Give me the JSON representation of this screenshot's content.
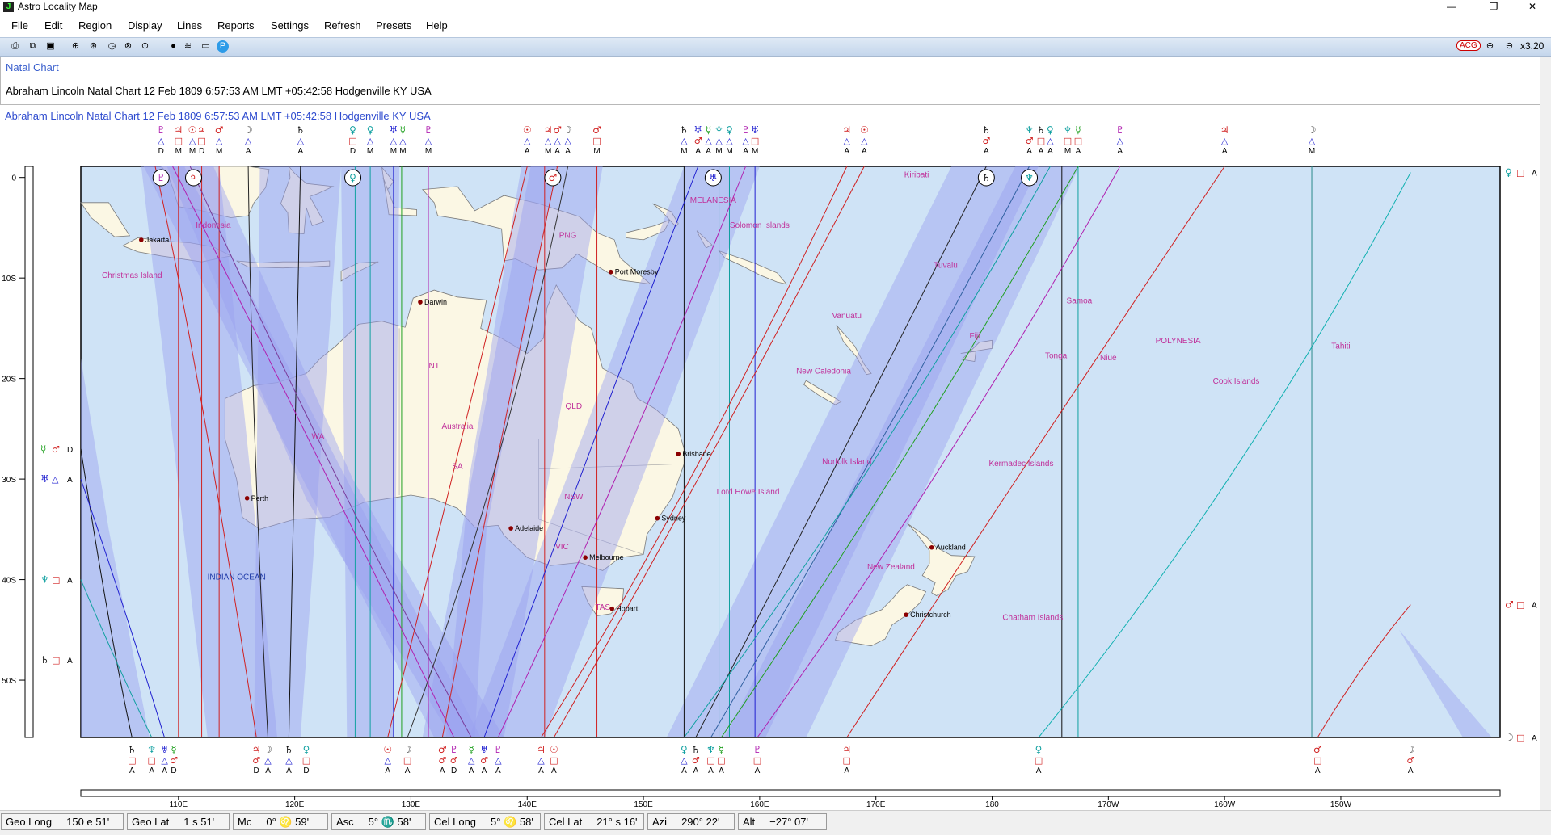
{
  "window": {
    "title": "Astro Locality Map",
    "minimize": "—",
    "restore": "❐",
    "close": "✕"
  },
  "menu": [
    "File",
    "Edit",
    "Region",
    "Display",
    "Lines",
    "Reports",
    "Settings",
    "Refresh",
    "Presets",
    "Help"
  ],
  "toolbar": {
    "acg_label": "ACG",
    "zoom_level": "x3.20"
  },
  "panel": {
    "tab": "Natal Chart",
    "chart_line": "Abraham Lincoln  Natal Chart  12 Feb 1809  6:57:53 AM  LMT +05:42:58  Hodgenville KY  USA"
  },
  "map": {
    "header": "Abraham Lincoln   Natal Chart   12 Feb 1809   6:57:53 AM   LMT +05:42:58   Hodgenville KY   USA",
    "lat_labels": [
      "0",
      "10S",
      "20S",
      "30S",
      "40S",
      "50S"
    ],
    "lon_labels": [
      "110E",
      "120E",
      "130E",
      "140E",
      "150E",
      "160E",
      "170E",
      "180",
      "170W",
      "160W",
      "150W"
    ],
    "regions": [
      {
        "label": "Indonesia",
        "lon": 113,
        "lat": -5
      },
      {
        "label": "Christmas Island",
        "lon": 106,
        "lat": -10
      },
      {
        "label": "PNG",
        "lon": 143.5,
        "lat": -6
      },
      {
        "label": "MELANESIA",
        "lon": 156,
        "lat": -2.5
      },
      {
        "label": "Solomon Islands",
        "lon": 160,
        "lat": -5
      },
      {
        "label": "Kiribati",
        "lon": 173.5,
        "lat": 0
      },
      {
        "label": "Tuvalu",
        "lon": 176,
        "lat": -9
      },
      {
        "label": "Vanuatu",
        "lon": 167.5,
        "lat": -14
      },
      {
        "label": "Samoa",
        "lon": -172.5,
        "lat": -12.5
      },
      {
        "label": "Fiji",
        "lon": 178.5,
        "lat": -16
      },
      {
        "label": "POLYNESIA",
        "lon": -164,
        "lat": -16.5
      },
      {
        "label": "Tahiti",
        "lon": -150,
        "lat": -17
      },
      {
        "label": "Tonga",
        "lon": -174.5,
        "lat": -18
      },
      {
        "label": "Niue",
        "lon": -170,
        "lat": -18.2
      },
      {
        "label": "New Caledonia",
        "lon": 165.5,
        "lat": -19.5
      },
      {
        "label": "Cook Islands",
        "lon": -159,
        "lat": -20.5
      },
      {
        "label": "NT",
        "lon": 132,
        "lat": -19
      },
      {
        "label": "QLD",
        "lon": 144,
        "lat": -23
      },
      {
        "label": "Australia",
        "lon": 134,
        "lat": -25
      },
      {
        "label": "WA",
        "lon": 122,
        "lat": -26
      },
      {
        "label": "SA",
        "lon": 134,
        "lat": -29
      },
      {
        "label": "Norfolk Island",
        "lon": 167.5,
        "lat": -28.5
      },
      {
        "label": "Kermadec Islands",
        "lon": -177.5,
        "lat": -28.7
      },
      {
        "label": "NSW",
        "lon": 144,
        "lat": -32
      },
      {
        "label": "Lord Howe Island",
        "lon": 159,
        "lat": -31.5
      },
      {
        "label": "VIC",
        "lon": 143,
        "lat": -37
      },
      {
        "label": "New Zealand",
        "lon": 171.3,
        "lat": -39
      },
      {
        "label": "INDIAN OCEAN",
        "lon": 115,
        "lat": -40
      },
      {
        "label": "TAS",
        "lon": 146.5,
        "lat": -43
      },
      {
        "label": "Chatham Islands",
        "lon": -176.5,
        "lat": -44
      }
    ],
    "cities": [
      {
        "name": "Jakarta",
        "lon": 106.8,
        "lat": -6.2
      },
      {
        "name": "Port Moresby",
        "lon": 147.2,
        "lat": -9.4
      },
      {
        "name": "Darwin",
        "lon": 130.8,
        "lat": -12.4
      },
      {
        "name": "Brisbane",
        "lon": 153,
        "lat": -27.5
      },
      {
        "name": "Perth",
        "lon": 115.9,
        "lat": -31.9
      },
      {
        "name": "Sydney",
        "lon": 151.2,
        "lat": -33.9
      },
      {
        "name": "Adelaide",
        "lon": 138.6,
        "lat": -34.9
      },
      {
        "name": "Melbourne",
        "lon": 145,
        "lat": -37.8
      },
      {
        "name": "Auckland",
        "lon": 174.8,
        "lat": -36.8
      },
      {
        "name": "Hobart",
        "lon": 147.3,
        "lat": -42.9
      },
      {
        "name": "Christchurch",
        "lon": 172.6,
        "lat": -43.5
      }
    ],
    "top_markers": [
      {
        "lon": 108.5,
        "g": "♇",
        "p": "#b020b0",
        "a": "△",
        "d": "D"
      },
      {
        "lon": 110,
        "g": "♃",
        "p": "#d02020",
        "a": "□",
        "d": "M"
      },
      {
        "lon": 111.2,
        "g": "☉",
        "p": "#d02020",
        "a": "△",
        "d": "M"
      },
      {
        "lon": 112,
        "g": "♃",
        "p": "#d02020",
        "a": "□",
        "d": "D"
      },
      {
        "lon": 113.5,
        "g": "♂",
        "p": "#d02020",
        "a": "△",
        "d": "M"
      },
      {
        "lon": 116,
        "g": "☽",
        "p": "#444",
        "a": "△",
        "d": "A"
      },
      {
        "lon": 120.5,
        "g": "♄",
        "p": "#111",
        "a": "△",
        "d": "A"
      },
      {
        "lon": 125,
        "g": "♀",
        "p": "#10a0a0",
        "a": "□",
        "d": "D"
      },
      {
        "lon": 126.5,
        "g": "♀",
        "p": "#10a0a0",
        "a": "△",
        "d": "M"
      },
      {
        "lon": 128.5,
        "g": "♅",
        "p": "#2020d0",
        "a": "△",
        "d": "M"
      },
      {
        "lon": 129.3,
        "g": "☿",
        "p": "#20a020",
        "a": "△",
        "d": "M"
      },
      {
        "lon": 131.5,
        "g": "♇",
        "p": "#b020b0",
        "a": "△",
        "d": "M"
      },
      {
        "lon": 140,
        "g": "☉",
        "p": "#d02020",
        "a": "△",
        "d": "A"
      },
      {
        "lon": 141.8,
        "g": "♃",
        "p": "#d02020",
        "a": "△",
        "d": "M"
      },
      {
        "lon": 142.6,
        "g": "♂",
        "p": "#d02020",
        "a": "△",
        "d": "A"
      },
      {
        "lon": 143.5,
        "g": "☽",
        "p": "#444",
        "a": "△",
        "d": "A"
      },
      {
        "lon": 146,
        "g": "♂",
        "p": "#d02020",
        "a": "□",
        "d": "M"
      },
      {
        "lon": 153.5,
        "g": "♄",
        "p": "#111",
        "a": "△",
        "d": "M"
      },
      {
        "lon": 154.7,
        "g": "♅",
        "p": "#2020d0",
        "a": "♂",
        "d": "A"
      },
      {
        "lon": 155.6,
        "g": "☿",
        "p": "#20a020",
        "a": "△",
        "d": "A"
      },
      {
        "lon": 156.5,
        "g": "♆",
        "p": "#10a0a0",
        "a": "△",
        "d": "M"
      },
      {
        "lon": 157.4,
        "g": "♀",
        "p": "#10a0a0",
        "a": "△",
        "d": "M"
      },
      {
        "lon": 158.8,
        "g": "♇",
        "p": "#b020b0",
        "a": "△",
        "d": "A"
      },
      {
        "lon": 159.6,
        "g": "♅",
        "p": "#2020d0",
        "a": "□",
        "d": "M"
      },
      {
        "lon": 167.5,
        "g": "♃",
        "p": "#d02020",
        "a": "△",
        "d": "A"
      },
      {
        "lon": 169,
        "g": "☉",
        "p": "#d02020",
        "a": "△",
        "d": "A"
      },
      {
        "lon": 179.5,
        "g": "♄",
        "p": "#111",
        "a": "♂",
        "d": "A"
      },
      {
        "lon": -176.8,
        "g": "♆",
        "p": "#10a0a0",
        "a": "♂",
        "d": "A"
      },
      {
        "lon": -175.8,
        "g": "♄",
        "p": "#111",
        "a": "□",
        "d": "A"
      },
      {
        "lon": -175,
        "g": "♀",
        "p": "#10a0a0",
        "a": "△",
        "d": "A"
      },
      {
        "lon": -173.5,
        "g": "♆",
        "p": "#10a0a0",
        "a": "□",
        "d": "M"
      },
      {
        "lon": -172.6,
        "g": "☿",
        "p": "#20a020",
        "a": "□",
        "d": "A"
      },
      {
        "lon": -169,
        "g": "♇",
        "p": "#b020b0",
        "a": "△",
        "d": "A"
      },
      {
        "lon": -160,
        "g": "♃",
        "p": "#d02020",
        "a": "△",
        "d": "A"
      },
      {
        "lon": -152.5,
        "g": "☽",
        "p": "#444",
        "a": "△",
        "d": "M"
      }
    ],
    "bottom_markers": [
      {
        "lon": 106,
        "g": "♄",
        "p": "#111",
        "a": "□",
        "d": "A"
      },
      {
        "lon": 107.7,
        "g": "♆",
        "p": "#10a0a0",
        "a": "□",
        "d": "A"
      },
      {
        "lon": 108.8,
        "g": "♅",
        "p": "#2020d0",
        "a": "△",
        "d": "A"
      },
      {
        "lon": 109.6,
        "g": "☿",
        "p": "#20a020",
        "a": "♂",
        "d": "D"
      },
      {
        "lon": 116.7,
        "g": "♃",
        "p": "#d02020",
        "a": "♂",
        "d": "D"
      },
      {
        "lon": 117.7,
        "g": "☽",
        "p": "#444",
        "a": "△",
        "d": "A"
      },
      {
        "lon": 119.5,
        "g": "♄",
        "p": "#111",
        "a": "△",
        "d": "A"
      },
      {
        "lon": 121,
        "g": "♀",
        "p": "#10a0a0",
        "a": "□",
        "d": "D"
      },
      {
        "lon": 128,
        "g": "☉",
        "p": "#d02020",
        "a": "△",
        "d": "A"
      },
      {
        "lon": 129.7,
        "g": "☽",
        "p": "#444",
        "a": "□",
        "d": "A"
      },
      {
        "lon": 132.7,
        "g": "♂",
        "p": "#d02020",
        "a": "♂",
        "d": "A"
      },
      {
        "lon": 133.7,
        "g": "♇",
        "p": "#b020b0",
        "a": "♂",
        "d": "D"
      },
      {
        "lon": 135.2,
        "g": "☿",
        "p": "#20a020",
        "a": "△",
        "d": "A"
      },
      {
        "lon": 136.3,
        "g": "♅",
        "p": "#2020d0",
        "a": "♂",
        "d": "A"
      },
      {
        "lon": 137.5,
        "g": "♇",
        "p": "#b020b0",
        "a": "△",
        "d": "A"
      },
      {
        "lon": 141.2,
        "g": "♃",
        "p": "#d02020",
        "a": "△",
        "d": "A"
      },
      {
        "lon": 142.3,
        "g": "☉",
        "p": "#d02020",
        "a": "□",
        "d": "A"
      },
      {
        "lon": 153.5,
        "g": "♀",
        "p": "#10a0a0",
        "a": "△",
        "d": "A"
      },
      {
        "lon": 154.5,
        "g": "♄",
        "p": "#111",
        "a": "♂",
        "d": "A"
      },
      {
        "lon": 155.8,
        "g": "♆",
        "p": "#10a0a0",
        "a": "□",
        "d": "A"
      },
      {
        "lon": 156.7,
        "g": "☿",
        "p": "#20a020",
        "a": "□",
        "d": "A"
      },
      {
        "lon": 159.8,
        "g": "♇",
        "p": "#b020b0",
        "a": "□",
        "d": "A"
      },
      {
        "lon": 167.5,
        "g": "♃",
        "p": "#d02020",
        "a": "□",
        "d": "A"
      },
      {
        "lon": -176,
        "g": "♀",
        "p": "#10a0a0",
        "a": "□",
        "d": "A"
      },
      {
        "lon": -152,
        "g": "♂",
        "p": "#d02020",
        "a": "□",
        "d": "A"
      },
      {
        "lon": -144,
        "g": "☽",
        "p": "#444",
        "a": "♂",
        "d": "A"
      }
    ],
    "left_markers": [
      {
        "lat": -27,
        "g": "☿",
        "g2": "♂",
        "d": "D"
      },
      {
        "lat": -30,
        "g": "♅",
        "g2": "△",
        "d": "A"
      },
      {
        "lat": -40,
        "g": "♆",
        "g2": "□",
        "d": "A"
      },
      {
        "lat": -48,
        "g": "♄",
        "g2": "□",
        "d": "A"
      }
    ],
    "right_markers": [
      {
        "lat": 0.5,
        "g": "♀",
        "g2": "□",
        "d": "A"
      },
      {
        "lat": -42.5,
        "g": "♂",
        "g2": "□",
        "d": "A"
      },
      {
        "lat": -55.7,
        "g": "☽",
        "g2": "□",
        "d": "A"
      }
    ],
    "circles": [
      {
        "lon": 108.5,
        "g": "♇"
      },
      {
        "lon": 111.3,
        "g": "♃"
      },
      {
        "lon": 125,
        "g": "♀"
      },
      {
        "lon": 142.2,
        "g": "♂"
      },
      {
        "lon": 156,
        "g": "♅"
      },
      {
        "lon": 179.5,
        "g": "♄"
      },
      {
        "lon": -176.8,
        "g": "♆"
      }
    ]
  },
  "status": [
    {
      "label": "Geo Long",
      "value": "150 e 51'"
    },
    {
      "label": "Geo Lat",
      "value": "1 s 51'"
    },
    {
      "label": "Mc",
      "value": "0° ♌ 59'"
    },
    {
      "label": "Asc",
      "value": "5° ♏ 58'"
    },
    {
      "label": "Cel Long",
      "value": "5° ♌ 58'"
    },
    {
      "label": "Cel Lat",
      "value": "21° s 16'"
    },
    {
      "label": "Azi",
      "value": "290° 22'"
    },
    {
      "label": "Alt",
      "value": "−27° 07'"
    }
  ],
  "colors": {
    "ocean": "#cfe3f6",
    "land": "#fbf7e4",
    "band": "#9aa0f0",
    "sun": "#d02020",
    "moon": "#444444",
    "mercury": "#20a020",
    "venus": "#10a0a0",
    "mars": "#d02020",
    "jupiter": "#d02020",
    "saturn": "#111111",
    "uranus": "#2020d0",
    "neptune": "#10a0a0",
    "pluto": "#b020b0"
  }
}
